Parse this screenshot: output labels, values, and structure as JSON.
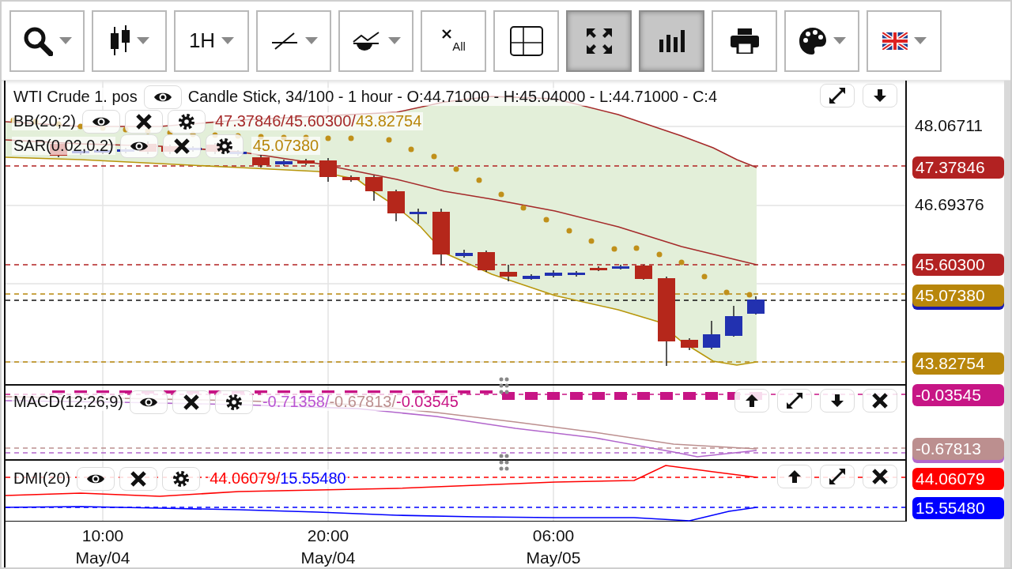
{
  "toolbar": [
    {
      "kind": "search",
      "dropdown": true,
      "on": false
    },
    {
      "kind": "candles",
      "dropdown": true,
      "on": false
    },
    {
      "kind": "timeframe",
      "label": "1H",
      "dropdown": true,
      "on": false
    },
    {
      "kind": "line",
      "dropdown": true,
      "on": false
    },
    {
      "kind": "indicator",
      "dropdown": true,
      "on": false
    },
    {
      "kind": "clear_all",
      "label": "All",
      "dropdown": false,
      "on": false
    },
    {
      "kind": "crosshair",
      "dropdown": false,
      "on": false
    },
    {
      "kind": "fullscreen",
      "dropdown": false,
      "on": true
    },
    {
      "kind": "volume",
      "dropdown": false,
      "on": true
    },
    {
      "kind": "print",
      "dropdown": false,
      "on": false
    },
    {
      "kind": "palette",
      "dropdown": true,
      "on": false
    },
    {
      "kind": "flag",
      "dropdown": true,
      "on": false
    }
  ],
  "price_pane": {
    "symbol": "WTI Crude 1. pos",
    "info": "Candle Stick, 34/100 - 1 hour - O:44.71000 - H:45.04000 - L:44.71000 - C:4",
    "pane_buttons": [
      {
        "kind": "expand"
      },
      {
        "kind": "down"
      }
    ],
    "indicators": [
      {
        "name": "BB(20;2)",
        "values": [
          {
            "text": "47.37846/45.60300/",
            "color": "#a52a2a"
          },
          {
            "text": "43.82754",
            "color": "#b8860b"
          }
        ]
      },
      {
        "name": "SAR(0.02,0.2)",
        "values": [
          {
            "text": "45.07380",
            "color": "#b8860b"
          }
        ]
      }
    ]
  },
  "macd_pane": {
    "name": "MACD(12;26;9)",
    "values": [
      {
        "text": "-0.71358/",
        "color": "#ba55d3"
      },
      {
        "text": "-0.67813/",
        "color": "#bc8f8f"
      },
      {
        "text": "-0.03545",
        "color": "#c71585"
      }
    ],
    "pane_buttons": [
      {
        "kind": "up"
      },
      {
        "kind": "expand"
      },
      {
        "kind": "down"
      },
      {
        "kind": "close"
      }
    ]
  },
  "dmi_pane": {
    "name": "DMI(20)",
    "values": [
      {
        "text": "44.06079/",
        "color": "#ff0000"
      },
      {
        "text": "15.55480",
        "color": "#0000ff"
      }
    ],
    "pane_buttons": [
      {
        "kind": "up"
      },
      {
        "kind": "expand"
      },
      {
        "kind": "close"
      }
    ]
  },
  "price_axis": {
    "ticks": [
      "48.06711",
      "46.69376"
    ],
    "labels": [
      {
        "kind": "tag",
        "text": "47.37846",
        "color": "#b22222"
      },
      {
        "kind": "tag",
        "text": "45.60300",
        "color": "#b22222"
      },
      {
        "kind": "covered",
        "color": "#1a1ab0"
      },
      {
        "kind": "tag",
        "text": "45.07380",
        "color": "#b8860b"
      },
      {
        "kind": "tag",
        "text": "43.82754",
        "color": "#b8860b"
      },
      {
        "kind": "tag",
        "text": "-0.03545",
        "color": "#c71585"
      },
      {
        "kind": "covered",
        "color": "#b266cc"
      },
      {
        "kind": "tag",
        "text": "-0.67813",
        "color": "#bc8f8f"
      },
      {
        "kind": "tag",
        "text": "44.06079",
        "color": "#ff0000"
      },
      {
        "kind": "tag",
        "text": "15.55480",
        "color": "#0000ff"
      }
    ]
  },
  "time_axis": [
    {
      "time": "10:00",
      "date": "May/04"
    },
    {
      "time": "20:00",
      "date": "May/04"
    },
    {
      "time": "06:00",
      "date": "May/05"
    }
  ]
}
